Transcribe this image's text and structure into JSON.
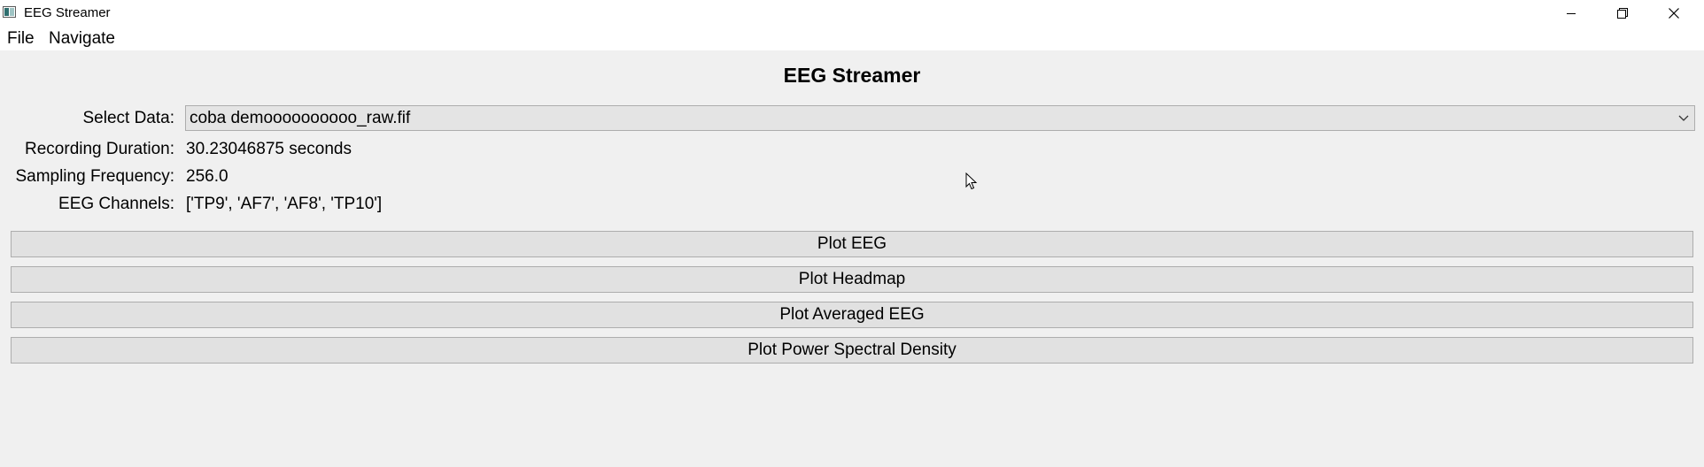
{
  "window": {
    "title": "EEG Streamer",
    "icons": {
      "app": "app-window-icon",
      "minimize": "minimize-icon",
      "maximize": "restore-icon",
      "close": "close-icon"
    }
  },
  "menubar": {
    "file_label": "File",
    "navigate_label": "Navigate"
  },
  "main": {
    "heading": "EEG Streamer",
    "select_data": {
      "label": "Select Data:",
      "value": "coba demoooooooooo_raw.fif"
    },
    "recording_duration": {
      "label": "Recording Duration:",
      "value": "30.23046875 seconds"
    },
    "sampling_frequency": {
      "label": "Sampling Frequency:",
      "value": "256.0"
    },
    "eeg_channels": {
      "label": "EEG Channels:",
      "value": "['TP9', 'AF7', 'AF8', 'TP10']"
    },
    "buttons": {
      "plot_eeg": "Plot EEG",
      "plot_headmap": "Plot Headmap",
      "plot_averaged_eeg": "Plot Averaged EEG",
      "plot_psd": "Plot Power Spectral Density"
    }
  },
  "colors": {
    "window_bg": "#f0f0f0",
    "titlebar_bg": "#ffffff",
    "button_bg": "#e1e1e1",
    "button_border": "#adadad"
  }
}
